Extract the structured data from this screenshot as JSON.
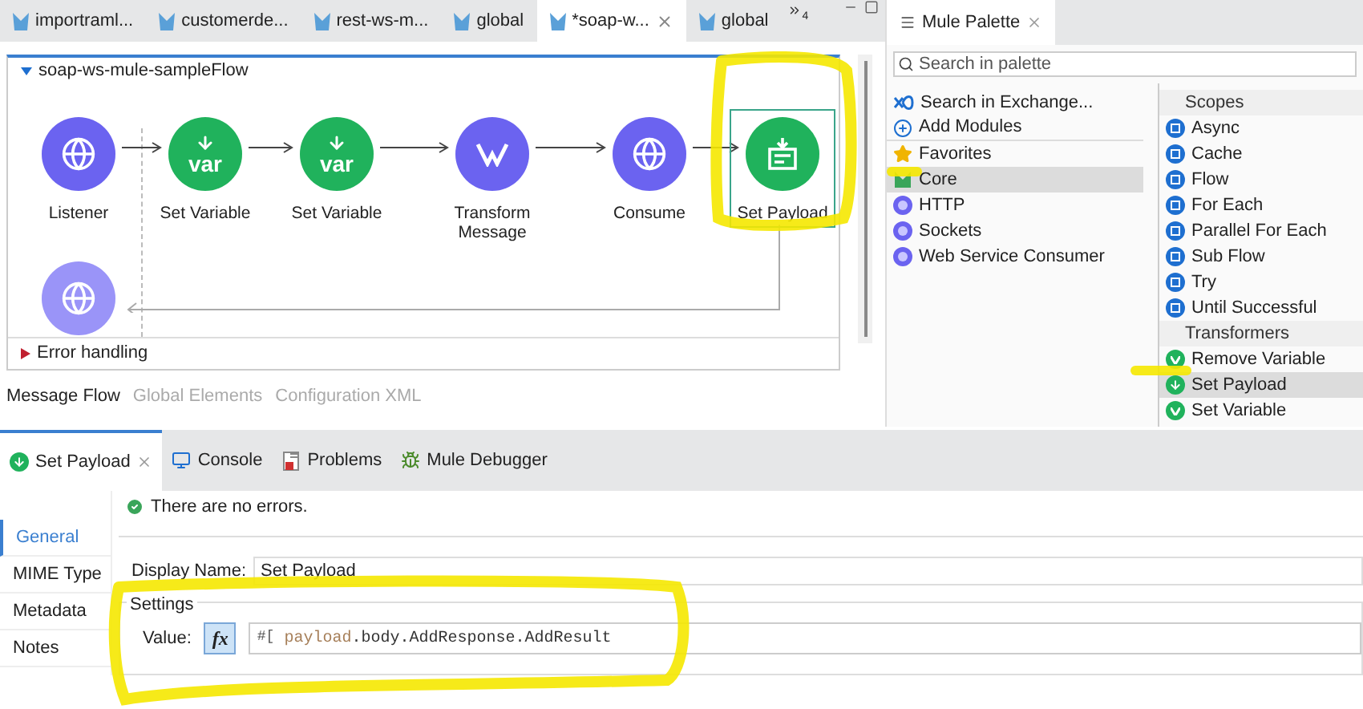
{
  "editor_tabs": [
    {
      "label": "importraml...",
      "selected": false
    },
    {
      "label": "customerde...",
      "selected": false
    },
    {
      "label": "rest-ws-m...",
      "selected": false
    },
    {
      "label": "global",
      "selected": false
    },
    {
      "label": "*soap-w...",
      "selected": true
    },
    {
      "label": "global",
      "selected": false
    }
  ],
  "tab_overflow": {
    "count": "4"
  },
  "flow": {
    "title": "soap-ws-mule-sampleFlow",
    "expanded": true,
    "nodes": [
      {
        "label": "Listener",
        "kind": "listener",
        "selected": false
      },
      {
        "label": "Set Variable",
        "kind": "set-variable",
        "icon_text": "var",
        "selected": false
      },
      {
        "label": "Set Variable",
        "kind": "set-variable",
        "icon_text": "var",
        "selected": false
      },
      {
        "label": "Transform\nMessage",
        "kind": "transform",
        "selected": false
      },
      {
        "label": "Consume",
        "kind": "consume",
        "selected": false
      },
      {
        "label": "Set Payload",
        "kind": "set-payload",
        "selected": true
      }
    ],
    "error_handling": {
      "label": "Error handling",
      "expanded": false
    }
  },
  "editor_bottom_tabs": [
    {
      "label": "Message Flow",
      "selected": true
    },
    {
      "label": "Global Elements",
      "selected": false
    },
    {
      "label": "Configuration XML",
      "selected": false
    }
  ],
  "palette": {
    "title": "Mule Palette",
    "search": {
      "placeholder": "Search in palette"
    },
    "modules": [
      {
        "label": "Search in Exchange...",
        "kind": "exchange",
        "selected": false
      },
      {
        "label": "Add Modules",
        "kind": "add",
        "selected": false
      },
      {
        "label": "Favorites",
        "kind": "star",
        "selected": false
      },
      {
        "label": "Core",
        "kind": "core",
        "selected": true
      },
      {
        "label": "HTTP",
        "kind": "connector",
        "selected": false
      },
      {
        "label": "Sockets",
        "kind": "connector",
        "selected": false
      },
      {
        "label": "Web Service Consumer",
        "kind": "connector",
        "selected": false
      }
    ],
    "components": [
      {
        "label": "Scopes",
        "kind": "header"
      },
      {
        "label": "Async",
        "kind": "scope",
        "selected": false
      },
      {
        "label": "Cache",
        "kind": "scope",
        "selected": false
      },
      {
        "label": "Flow",
        "kind": "scope",
        "selected": false
      },
      {
        "label": "For Each",
        "kind": "scope",
        "selected": false
      },
      {
        "label": "Parallel For Each",
        "kind": "scope",
        "selected": false
      },
      {
        "label": "Sub Flow",
        "kind": "scope",
        "selected": false
      },
      {
        "label": "Try",
        "kind": "scope",
        "selected": false
      },
      {
        "label": "Until Successful",
        "kind": "scope",
        "selected": false
      },
      {
        "label": "Transformers",
        "kind": "header"
      },
      {
        "label": "Remove Variable",
        "kind": "transformer",
        "selected": false
      },
      {
        "label": "Set Payload",
        "kind": "payload",
        "selected": true
      },
      {
        "label": "Set Variable",
        "kind": "transformer",
        "selected": false
      }
    ]
  },
  "bottom_tabs": [
    {
      "label": "Set Payload",
      "kind": "payload",
      "selected": true
    },
    {
      "label": "Console",
      "kind": "console",
      "selected": false
    },
    {
      "label": "Problems",
      "kind": "problems",
      "selected": false
    },
    {
      "label": "Mule Debugger",
      "kind": "debugger",
      "selected": false
    }
  ],
  "properties": {
    "nav": [
      {
        "label": "General",
        "selected": true
      },
      {
        "label": "MIME Type",
        "selected": false
      },
      {
        "label": "Metadata",
        "selected": false
      },
      {
        "label": "Notes",
        "selected": false
      }
    ],
    "status": "There are no errors.",
    "display_name": {
      "label": "Display Name:",
      "value": "Set Payload"
    },
    "settings": {
      "title": "Settings",
      "value_label": "Value:",
      "fx_button": {
        "label": "fx",
        "pressed": true
      },
      "expression": [
        {
          "text": "#[",
          "kind": "delimiter"
        },
        {
          "text": " payload",
          "kind": "keyword"
        },
        {
          "text": ".body.AddResponse.AddResult",
          "kind": "plain"
        }
      ]
    }
  }
}
